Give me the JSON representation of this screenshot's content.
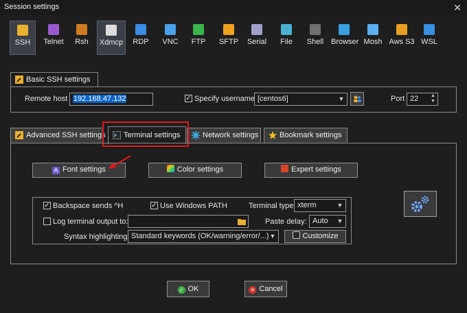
{
  "window": {
    "title": "Session settings",
    "close_glyph": "✕"
  },
  "protocols": [
    {
      "label": "SSH",
      "icon": "ssh-icon",
      "color": "#e8b030"
    },
    {
      "label": "Telnet",
      "icon": "telnet-icon",
      "color": "#9b59d0"
    },
    {
      "label": "Rsh",
      "icon": "rsh-icon",
      "color": "#d07a20"
    },
    {
      "label": "Xdmcp",
      "icon": "xdmcp-icon",
      "color": "#dcdcdc"
    },
    {
      "label": "RDP",
      "icon": "rdp-icon",
      "color": "#3a8ee6"
    },
    {
      "label": "VNC",
      "icon": "vnc-icon",
      "color": "#4aa0e8"
    },
    {
      "label": "FTP",
      "icon": "ftp-icon",
      "color": "#39b54a"
    },
    {
      "label": "SFTP",
      "icon": "sftp-icon",
      "color": "#f0a020"
    },
    {
      "label": "Serial",
      "icon": "serial-icon",
      "color": "#a0a0c8"
    },
    {
      "label": "File",
      "icon": "file-icon",
      "color": "#4ab0d0"
    },
    {
      "label": "Shell",
      "icon": "shell-icon",
      "color": "#707070"
    },
    {
      "label": "Browser",
      "icon": "browser-icon",
      "color": "#3aa0e0"
    },
    {
      "label": "Mosh",
      "icon": "mosh-icon",
      "color": "#5ab0f0"
    },
    {
      "label": "Aws S3",
      "icon": "aws-s3-icon",
      "color": "#e8a020"
    },
    {
      "label": "WSL",
      "icon": "wsl-icon",
      "color": "#3a90e0"
    }
  ],
  "basic": {
    "tab_label": "Basic SSH settings",
    "remote_host_label": "Remote host *",
    "remote_host_value": "192.168.47.132",
    "specify_username_label": "Specify username",
    "specify_username_checked": "✓",
    "username_value": "[centos6]",
    "port_label": "Port",
    "port_value": "22"
  },
  "tabs": [
    {
      "label": "Advanced SSH settings"
    },
    {
      "label": "Terminal settings"
    },
    {
      "label": "Network settings"
    },
    {
      "label": "Bookmark settings"
    }
  ],
  "terminal": {
    "font_button": "Font settings",
    "color_button": "Color settings",
    "expert_button": "Expert settings",
    "backspace_label": "Backspace sends ^H",
    "backspace_checked": "✓",
    "winpath_label": "Use Windows PATH",
    "winpath_checked": "✓",
    "terminal_type_label": "Terminal type:",
    "terminal_type_value": "xterm",
    "log_label": "Log terminal output to:",
    "log_path_value": "",
    "paste_delay_label": "Paste delay:",
    "paste_delay_value": "Auto",
    "syntax_label": "Syntax highlighting:",
    "syntax_value": "Standard keywords (OK/warning/error/...)",
    "customize_button": "Customize"
  },
  "footer": {
    "ok_label": "OK",
    "cancel_label": "Cancel"
  },
  "colors": {
    "ok_green": "#3cb043",
    "cancel_red": "#d9342b",
    "highlight_red": "#e0191b",
    "selection_blue": "#0a64c8"
  }
}
